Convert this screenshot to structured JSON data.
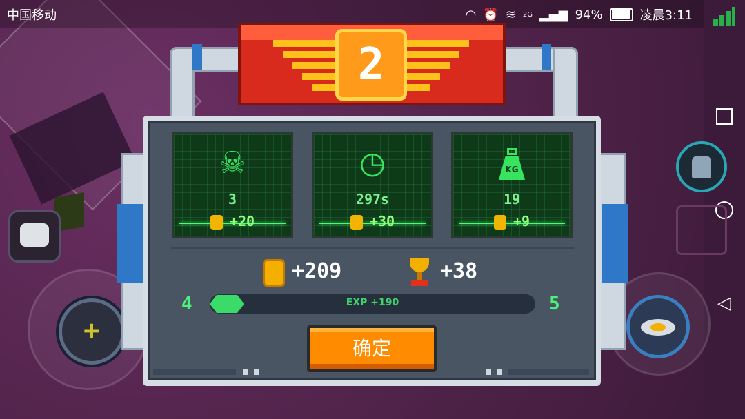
{
  "status_bar": {
    "carrier": "中国移动",
    "network": "2G",
    "battery": "94%",
    "time": "凌晨3:11"
  },
  "dialog": {
    "level": "2",
    "stats": [
      {
        "icon": "skull-icon",
        "value": "3",
        "reward": "+20"
      },
      {
        "icon": "clock-icon",
        "value": "297s",
        "reward": "+30"
      },
      {
        "icon": "weight-icon",
        "icon_label": "KG",
        "value": "19",
        "reward": "+9"
      }
    ],
    "total_coins": "+209",
    "trophies": "+38",
    "exp": {
      "current_level": "4",
      "next_level": "5",
      "label": "EXP +190",
      "progress": 0.1
    },
    "confirm_label": "确定"
  },
  "colors": {
    "accent_green": "#37e35f",
    "banner_red": "#d92a1e",
    "button_orange": "#ff8c00",
    "coin_gold": "#f4b000"
  }
}
